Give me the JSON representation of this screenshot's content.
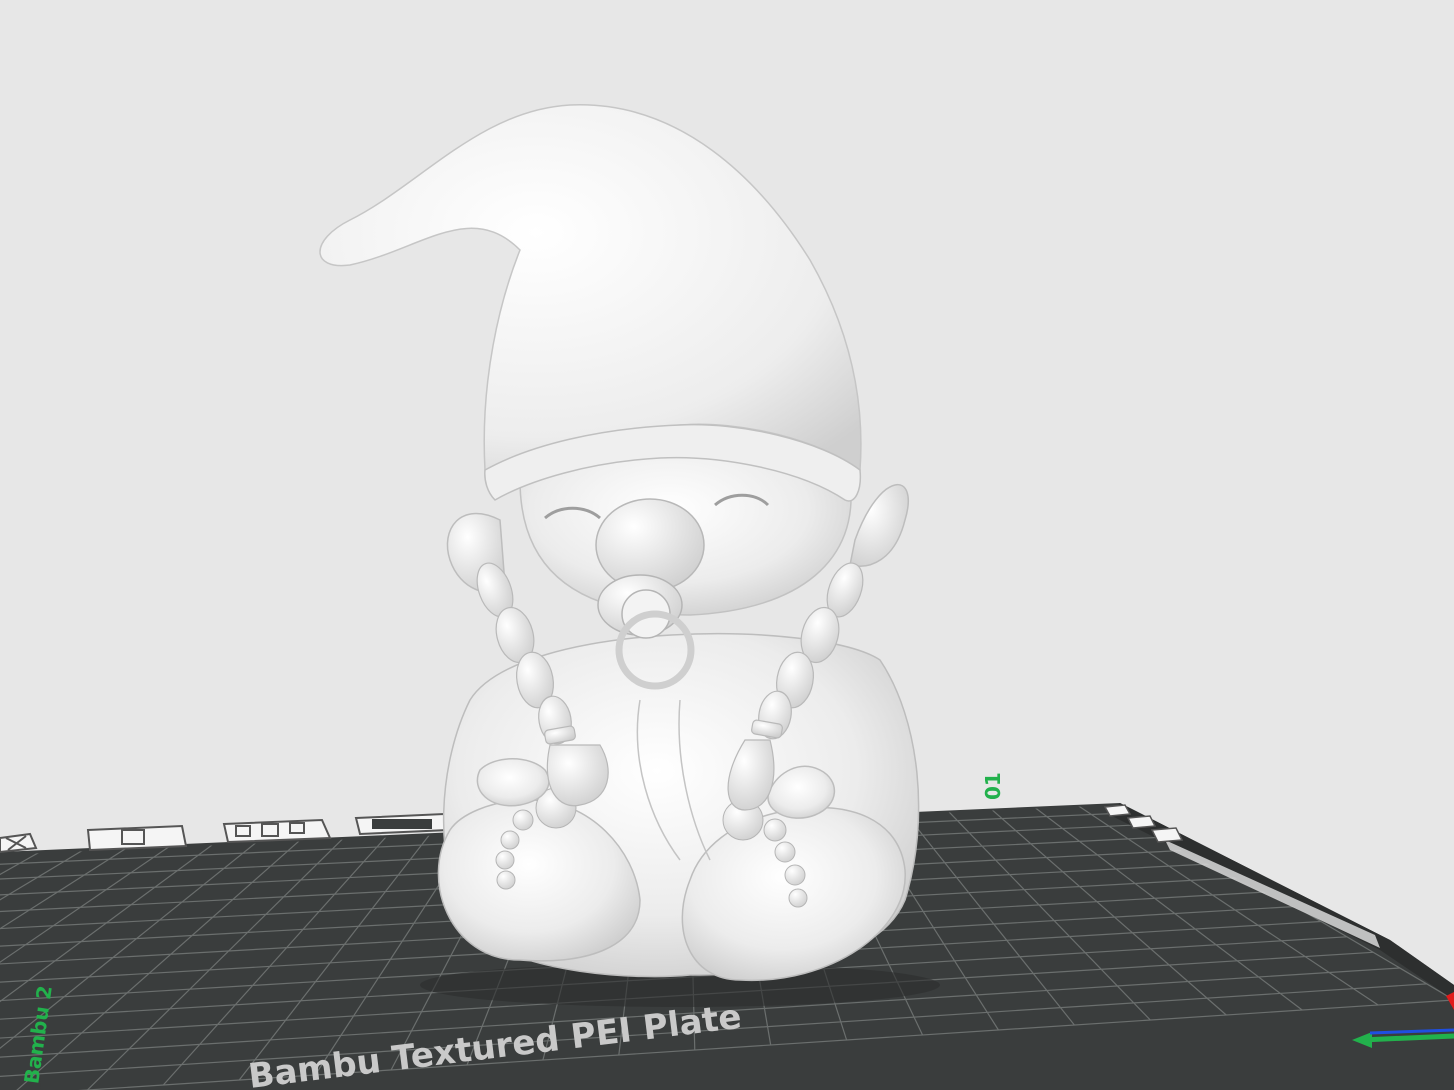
{
  "viewport": {
    "background_color": "#e7e7e7"
  },
  "build_plate": {
    "label": "Bambu Textured PEI Plate",
    "plate_color": "#3a3d3d",
    "grid_color": "#6b6f6e",
    "plate_index": "01",
    "corner_label": "Bambu 2"
  },
  "plate_icons": [
    {
      "name": "close-plate-icon"
    },
    {
      "name": "lock-plate-icon"
    },
    {
      "name": "arrange-plate-icon"
    },
    {
      "name": "orient-plate-icon"
    }
  ],
  "model": {
    "name": "gnome-model",
    "color": "#f0f0f0"
  },
  "axes": {
    "x_color": "#e01b1b",
    "y_color": "#22b14c",
    "z_color": "#1f4fe0"
  }
}
